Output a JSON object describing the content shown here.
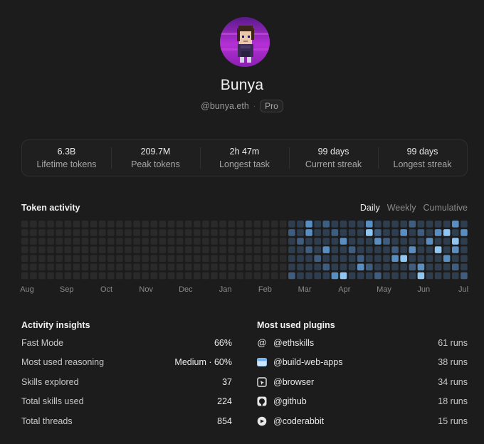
{
  "profile": {
    "name": "Bunya",
    "handle": "@bunya.eth",
    "separator": "·",
    "badge": "Pro"
  },
  "stats": [
    {
      "value": "6.3B",
      "label": "Lifetime tokens"
    },
    {
      "value": "209.7M",
      "label": "Peak tokens"
    },
    {
      "value": "2h 47m",
      "label": "Longest task"
    },
    {
      "value": "99 days",
      "label": "Current streak"
    },
    {
      "value": "99 days",
      "label": "Longest streak"
    }
  ],
  "token_activity": {
    "title": "Token activity",
    "tabs": [
      {
        "label": "Daily",
        "active": true
      },
      {
        "label": "Weekly",
        "active": false
      },
      {
        "label": "Cumulative",
        "active": false
      }
    ],
    "months": [
      "Aug",
      "Sep",
      "Oct",
      "Nov",
      "Dec",
      "Jan",
      "Feb",
      "Mar",
      "Apr",
      "May",
      "Jun",
      "Jul"
    ],
    "colors": {
      "empty": "#2a2a2a",
      "level1": "#2f3e4f",
      "level2": "#3f5d7f",
      "level3": "#5a8dc0",
      "level4": "#8fc6f2"
    },
    "active_from_week": 31,
    "weeks": 52,
    "days": 7,
    "high_cells": [
      [
        33,
        0
      ],
      [
        33,
        1
      ],
      [
        35,
        3
      ],
      [
        36,
        6
      ],
      [
        37,
        2
      ],
      [
        39,
        5
      ],
      [
        40,
        0
      ],
      [
        41,
        2
      ],
      [
        43,
        4
      ],
      [
        44,
        1
      ],
      [
        45,
        3
      ],
      [
        46,
        5
      ],
      [
        47,
        2
      ],
      [
        48,
        1
      ],
      [
        49,
        4
      ],
      [
        50,
        0
      ],
      [
        50,
        3
      ],
      [
        51,
        1
      ]
    ],
    "peak_cells": [
      [
        37,
        6
      ],
      [
        40,
        1
      ],
      [
        44,
        4
      ],
      [
        46,
        6
      ],
      [
        48,
        3
      ],
      [
        49,
        1
      ],
      [
        50,
        2
      ]
    ]
  },
  "insights": {
    "title": "Activity insights",
    "rows": [
      {
        "label": "Fast Mode",
        "value": "66%"
      },
      {
        "label": "Most used reasoning",
        "value": "Medium · 60%"
      },
      {
        "label": "Skills explored",
        "value": "37"
      },
      {
        "label": "Total skills used",
        "value": "224"
      },
      {
        "label": "Total threads",
        "value": "854"
      }
    ]
  },
  "plugins": {
    "title": "Most used plugins",
    "items": [
      {
        "icon": "at-icon",
        "name": "@ethskills",
        "runs": "61 runs"
      },
      {
        "icon": "web-app-icon",
        "name": "@build-web-apps",
        "runs": "38 runs"
      },
      {
        "icon": "browser-icon",
        "name": "@browser",
        "runs": "34 runs"
      },
      {
        "icon": "github-icon",
        "name": "@github",
        "runs": "18 runs"
      },
      {
        "icon": "coderabbit-icon",
        "name": "@coderabbit",
        "runs": "15 runs"
      }
    ]
  }
}
